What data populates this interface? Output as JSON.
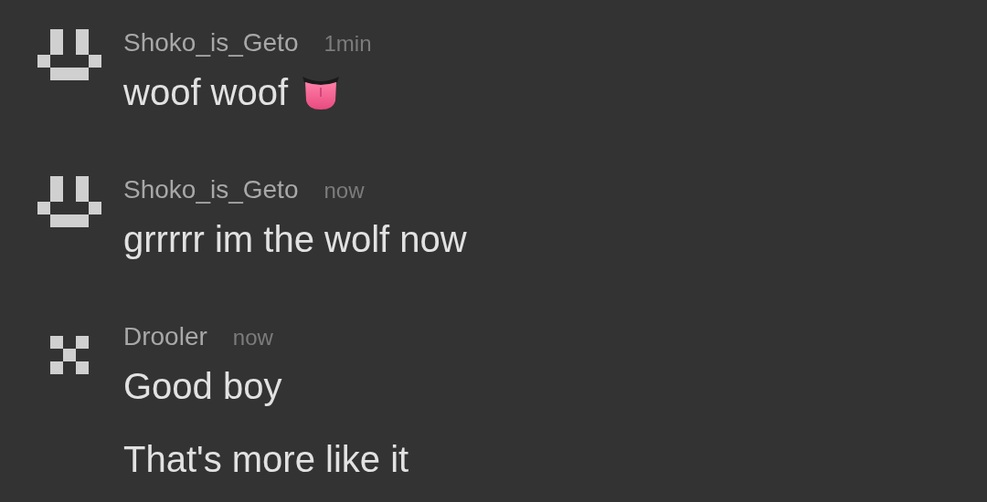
{
  "messages": [
    {
      "author": "Shoko_is_Geto",
      "time": "1min",
      "avatar": {
        "kind": "smile"
      },
      "lines": [
        {
          "text": "woof woof",
          "emoji": {
            "kind": "tongue"
          }
        }
      ]
    },
    {
      "author": "Shoko_is_Geto",
      "time": "now",
      "avatar": {
        "kind": "smile"
      },
      "lines": [
        {
          "text": "grrrrr im the wolf now"
        }
      ]
    },
    {
      "author": "Drooler",
      "time": "now",
      "avatar": {
        "kind": "cross"
      },
      "lines": [
        {
          "text": "Good boy"
        },
        {
          "text": "That's more like it"
        }
      ]
    }
  ]
}
